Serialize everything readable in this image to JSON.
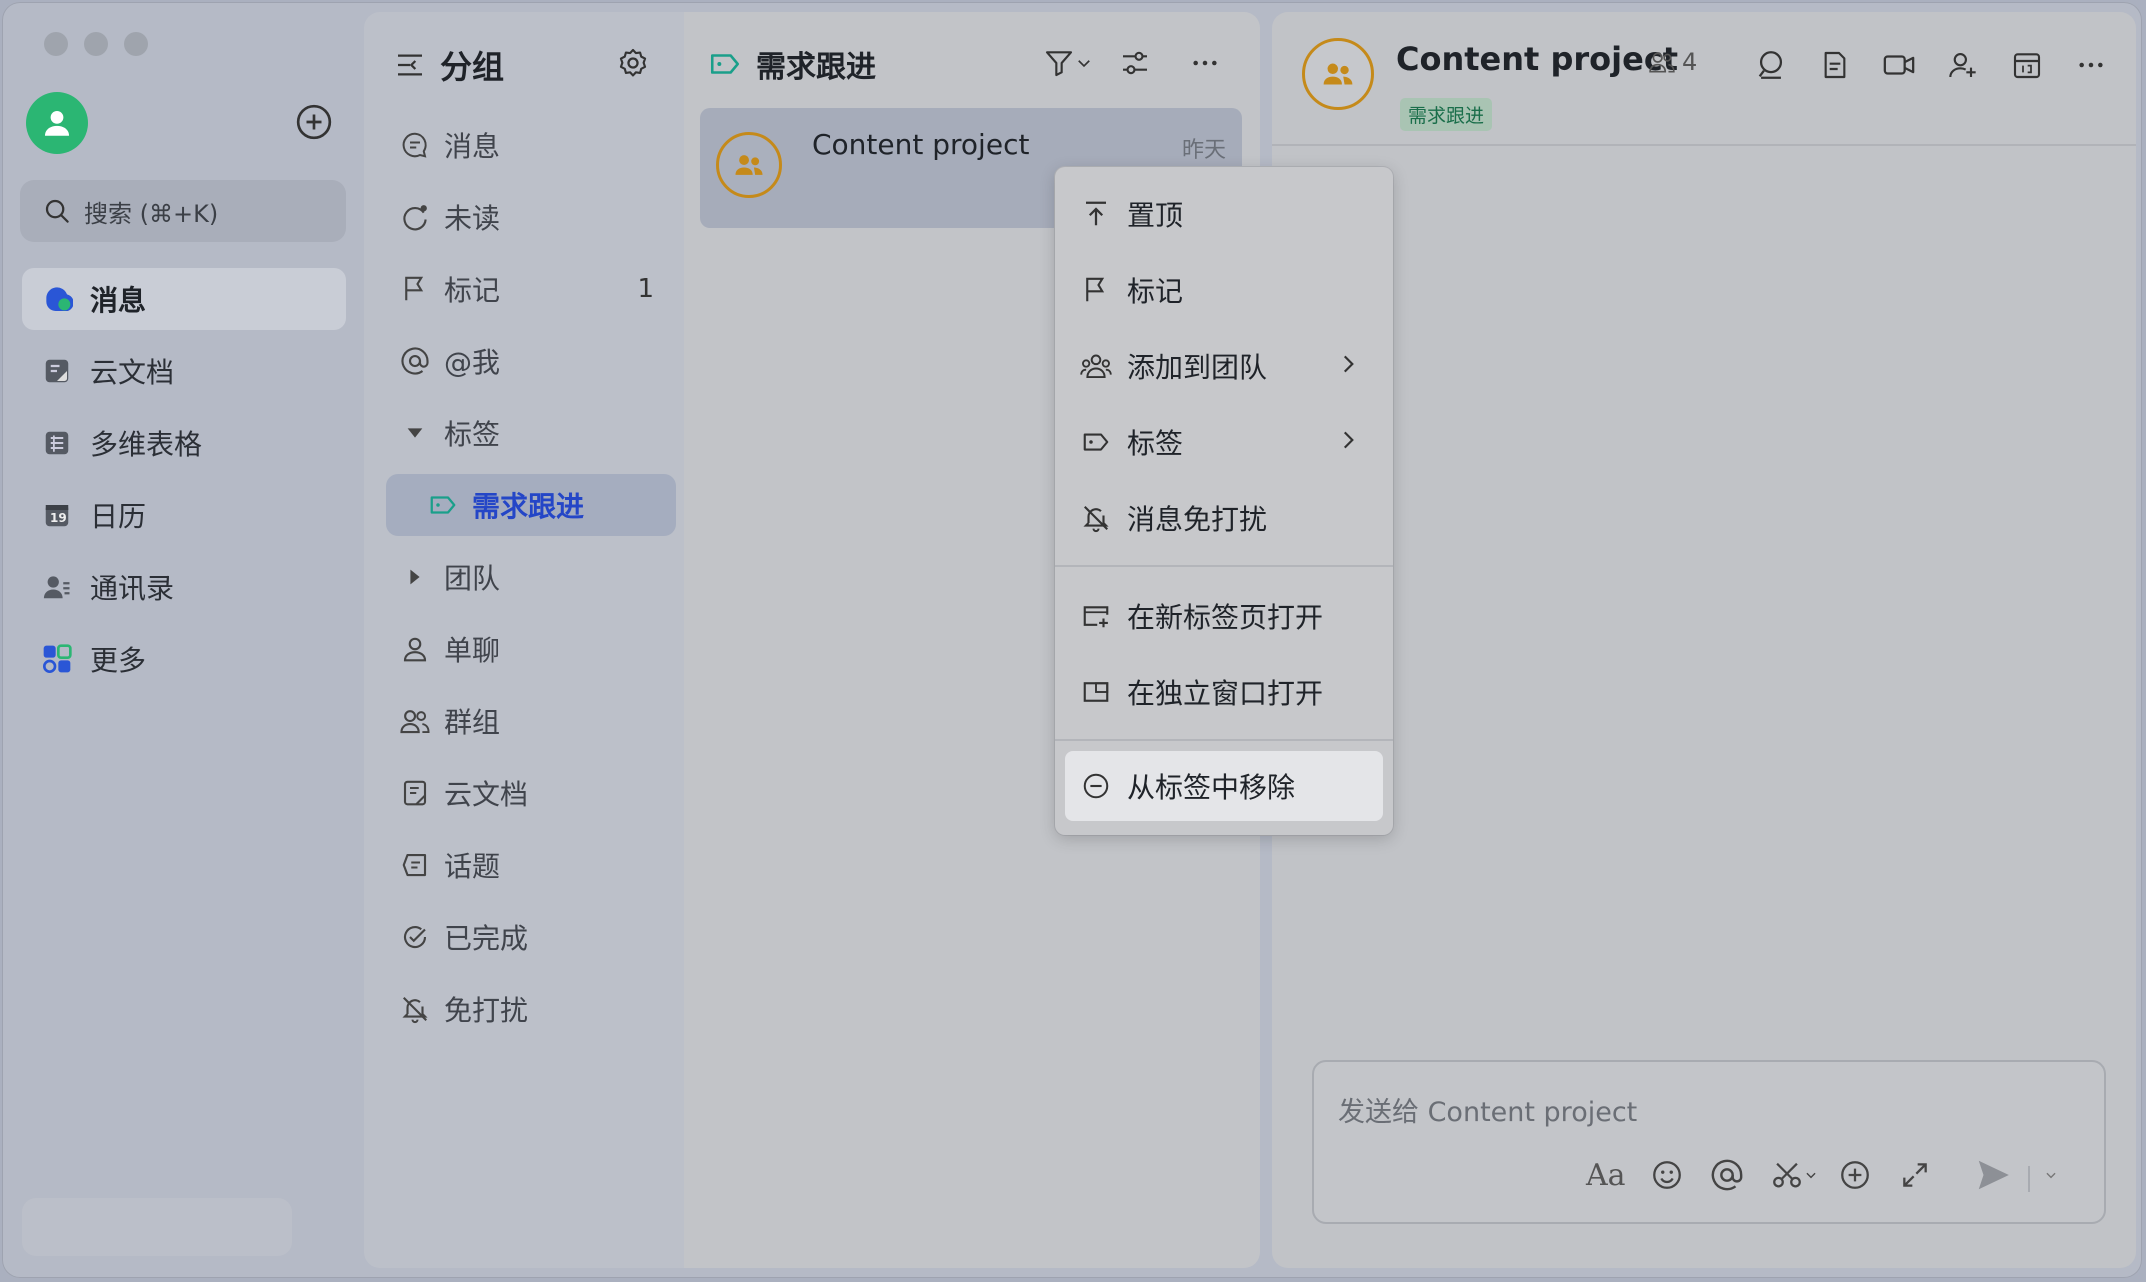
{
  "nav": {
    "search_placeholder": "搜索 (⌘+K)",
    "items": [
      {
        "label": "消息"
      },
      {
        "label": "云文档"
      },
      {
        "label": "多维表格"
      },
      {
        "label": "日历",
        "icon_text": "19"
      },
      {
        "label": "通讯录"
      },
      {
        "label": "更多"
      }
    ]
  },
  "groups": {
    "title": "分组",
    "items": [
      {
        "label": "消息"
      },
      {
        "label": "未读"
      },
      {
        "label": "标记",
        "count": "1"
      },
      {
        "label": "@我"
      },
      {
        "label": "标签"
      },
      {
        "label": "需求跟进"
      },
      {
        "label": "团队"
      },
      {
        "label": "单聊"
      },
      {
        "label": "群组"
      },
      {
        "label": "云文档"
      },
      {
        "label": "话题"
      },
      {
        "label": "已完成"
      },
      {
        "label": "免打扰"
      }
    ]
  },
  "chatlist": {
    "title": "需求跟进",
    "chats": [
      {
        "name": "Content project",
        "time": "昨天"
      }
    ]
  },
  "conversation": {
    "title": "Content project",
    "member_count": "4",
    "tag": "需求跟进",
    "input_placeholder": "发送给 Content project",
    "toolbar_text_icon": "Aa"
  },
  "context_menu": {
    "items": [
      {
        "label": "置顶"
      },
      {
        "label": "标记"
      },
      {
        "label": "添加到团队"
      },
      {
        "label": "标签"
      },
      {
        "label": "消息免打扰"
      },
      {
        "label": "在新标签页打开"
      },
      {
        "label": "在独立窗口打开"
      },
      {
        "label": "从标签中移除"
      }
    ]
  },
  "colors": {
    "accent_blue": "#2446c7",
    "avatar_green": "#2bb673",
    "group_avatar_ring": "#c58a1a",
    "tag_green": "#1a8f5c"
  }
}
